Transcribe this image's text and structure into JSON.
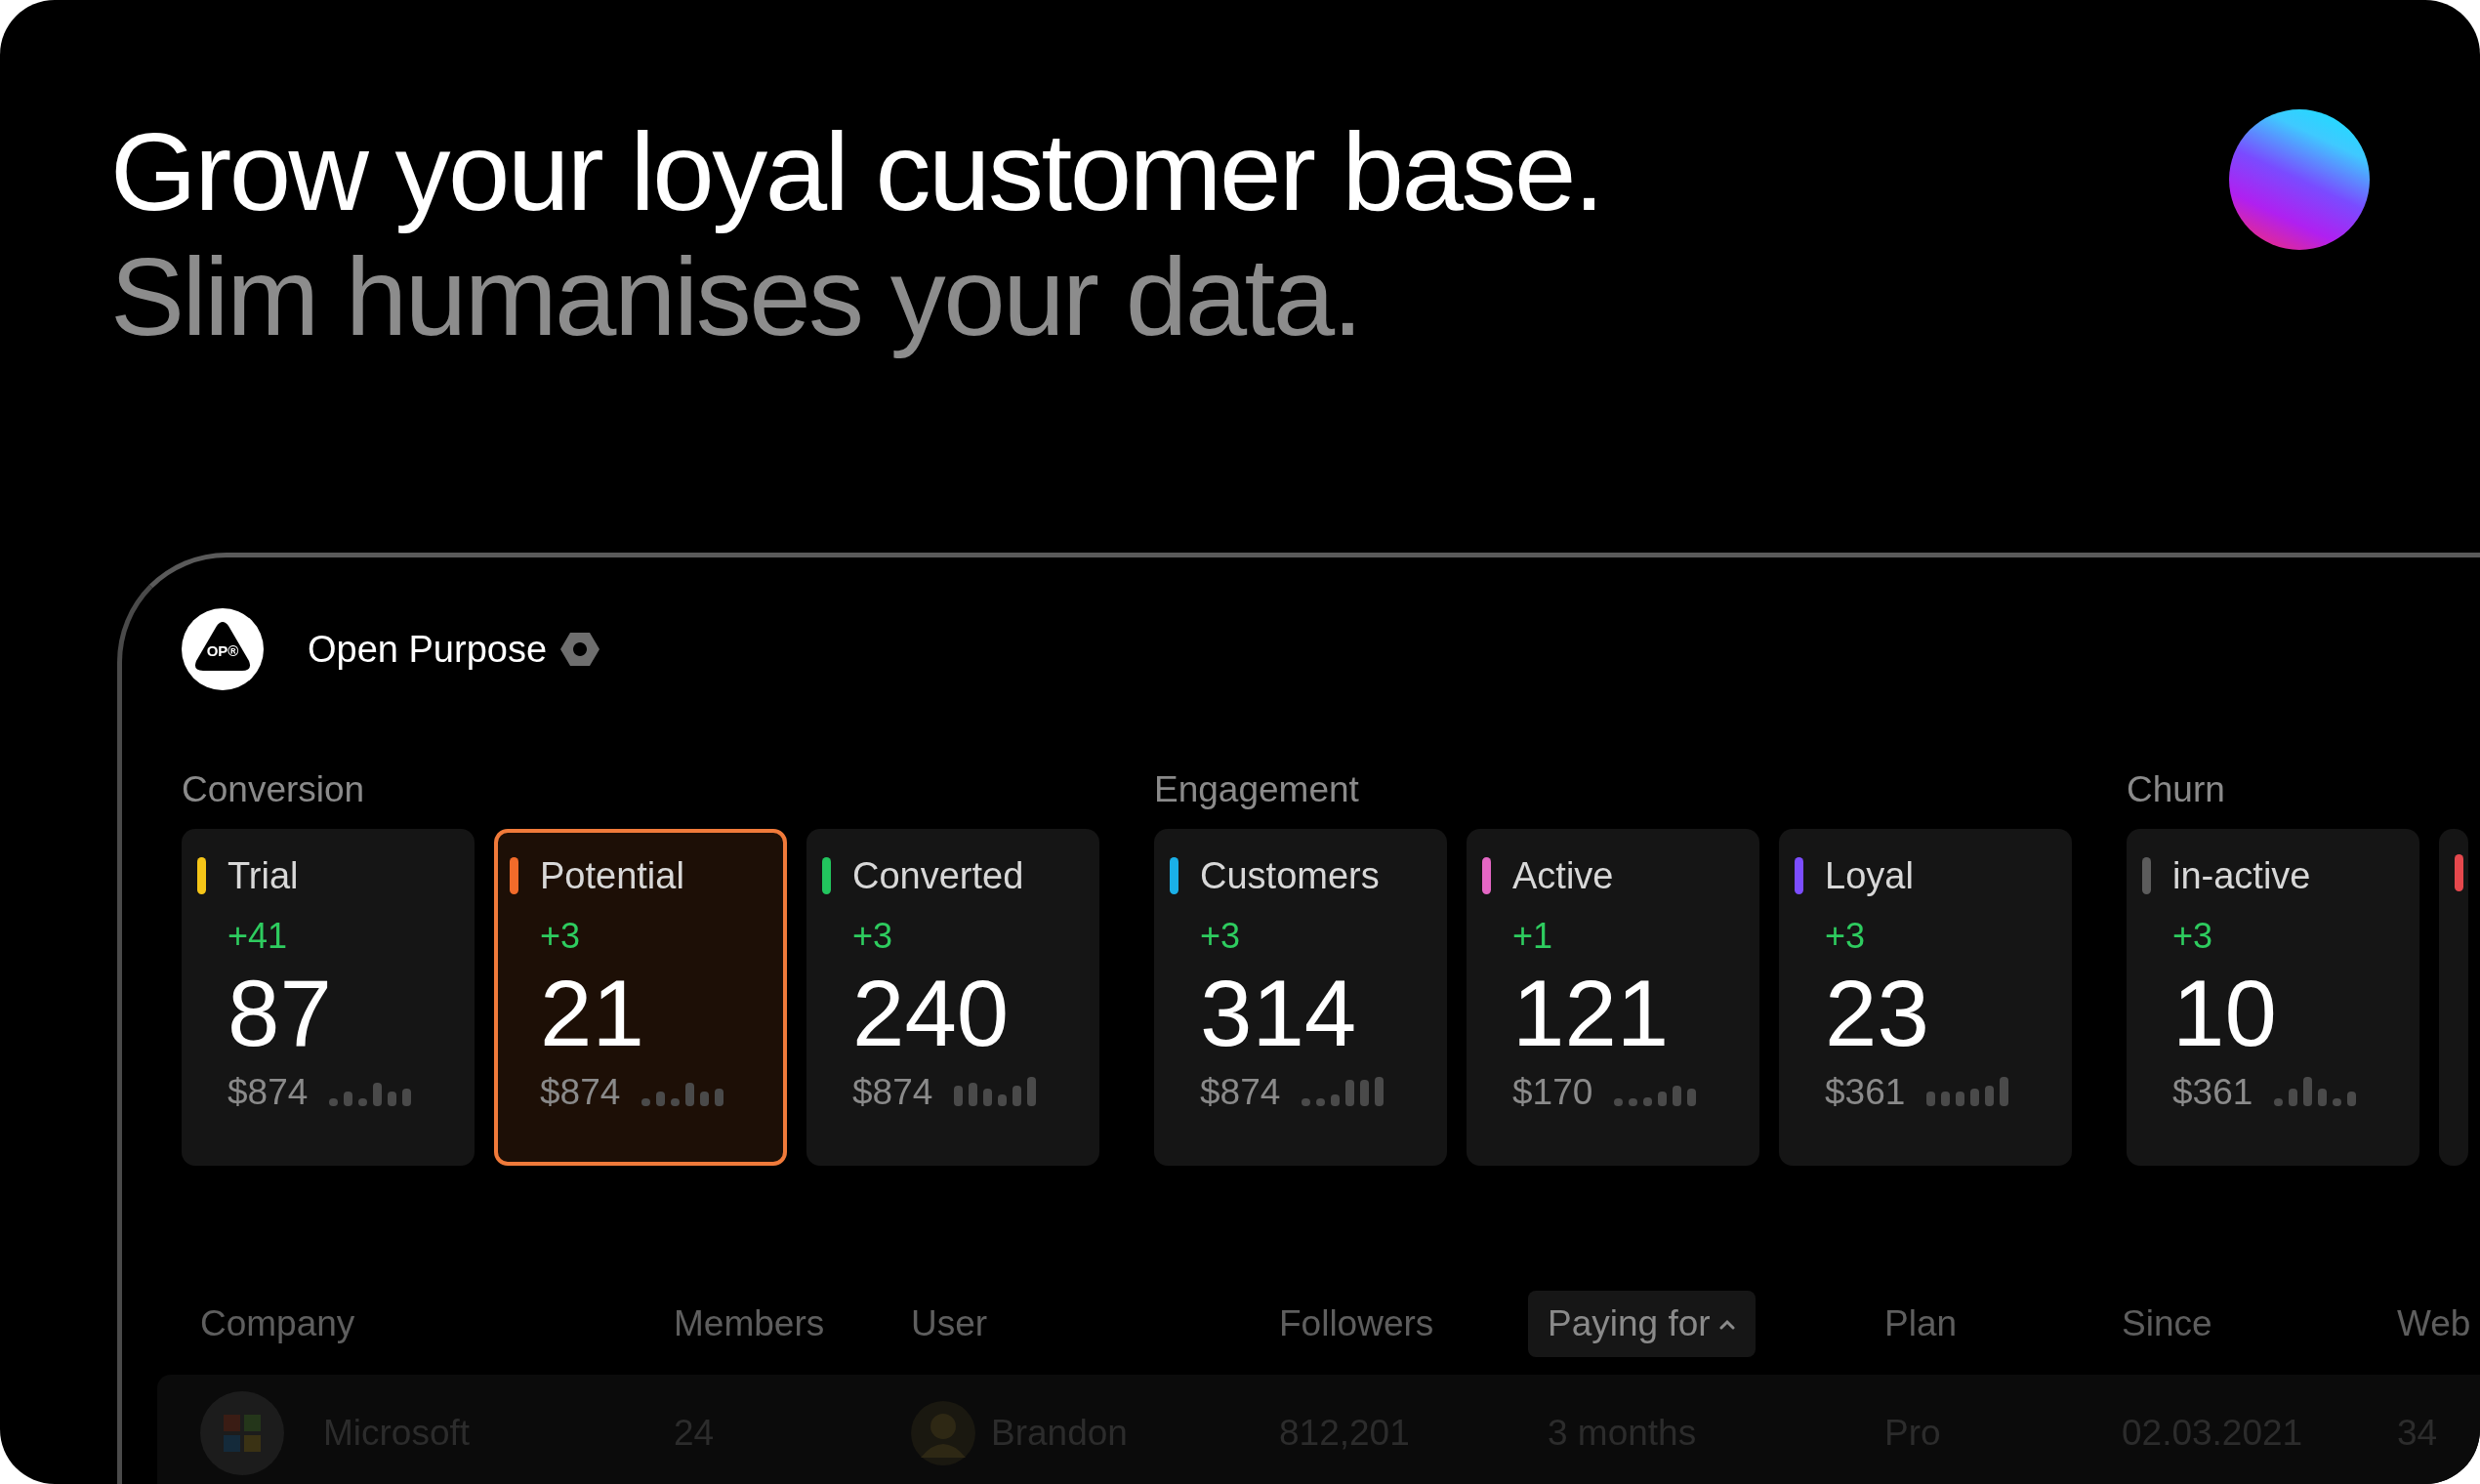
{
  "headline": {
    "title": "Grow your loyal customer base.",
    "subtitle": "Slim humanises your data."
  },
  "app": {
    "logo_text": "OP®",
    "workspace": "Open Purpose"
  },
  "groups": [
    {
      "title": "Conversion",
      "cards": [
        {
          "label": "Trial",
          "color": "#f5c518",
          "delta": "+41",
          "value": "87",
          "amount": "$874",
          "selected": false
        },
        {
          "label": "Potential",
          "color": "#f26b2a",
          "delta": "+3",
          "value": "21",
          "amount": "$874",
          "selected": true
        },
        {
          "label": "Converted",
          "color": "#22c55e",
          "delta": "+3",
          "value": "240",
          "amount": "$874",
          "selected": false
        }
      ]
    },
    {
      "title": "Engagement",
      "cards": [
        {
          "label": "Customers",
          "color": "#1ab0e8",
          "delta": "+3",
          "value": "314",
          "amount": "$874",
          "selected": false
        },
        {
          "label": "Active",
          "color": "#e467c4",
          "delta": "+1",
          "value": "121",
          "amount": "$170",
          "selected": false
        },
        {
          "label": "Loyal",
          "color": "#7c4dff",
          "delta": "+3",
          "value": "23",
          "amount": "$361",
          "selected": false
        }
      ]
    },
    {
      "title": "Churn",
      "cards": [
        {
          "label": "in-active",
          "color": "#5c5c5c",
          "delta": "+3",
          "value": "10",
          "amount": "$361",
          "selected": false
        },
        {
          "color": "#e5484d",
          "selected": false
        }
      ]
    }
  ],
  "table": {
    "columns": [
      {
        "label": "Company",
        "sorted": false
      },
      {
        "label": "Members",
        "sorted": false
      },
      {
        "label": "User",
        "sorted": false
      },
      {
        "label": "Followers",
        "sorted": false
      },
      {
        "label": "Paying for",
        "sorted": true
      },
      {
        "label": "Plan",
        "sorted": false
      },
      {
        "label": "Since",
        "sorted": false
      },
      {
        "label": "Web",
        "sorted": false
      }
    ],
    "rows": [
      {
        "cells": [
          "Microsoft",
          "24",
          "Brandon",
          "812,201",
          "3 months",
          "Pro",
          "02.03.2021",
          "34"
        ]
      }
    ]
  }
}
